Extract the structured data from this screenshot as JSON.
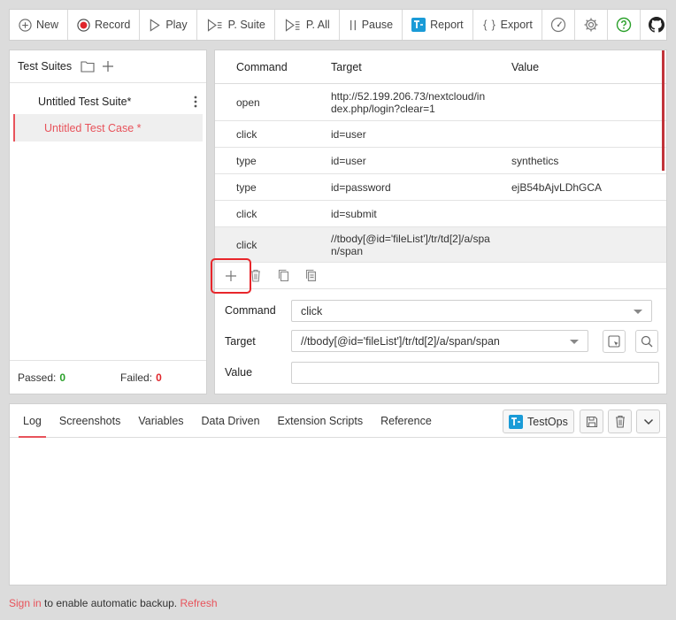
{
  "toolbar": {
    "new_label": "New",
    "record_label": "Record",
    "play_label": "Play",
    "psuite_label": "P. Suite",
    "pall_label": "P. All",
    "pause_label": "Pause",
    "report_label": "Report",
    "export_label": "Export"
  },
  "sidebar": {
    "title": "Test Suites",
    "suite_name": "Untitled Test Suite*",
    "case_name": "Untitled Test Case *",
    "passed_label": "Passed:",
    "passed_count": "0",
    "failed_label": "Failed:",
    "failed_count": "0"
  },
  "table": {
    "headers": {
      "command": "Command",
      "target": "Target",
      "value": "Value"
    },
    "rows": [
      {
        "command": "open",
        "target": "http://52.199.206.73/nextcloud/index.php/login?clear=1",
        "value": ""
      },
      {
        "command": "click",
        "target": "id=user",
        "value": ""
      },
      {
        "command": "type",
        "target": "id=user",
        "value": "synthetics"
      },
      {
        "command": "type",
        "target": "id=password",
        "value": "ejB54bAjvLDhGCA"
      },
      {
        "command": "click",
        "target": "id=submit",
        "value": ""
      },
      {
        "command": "click",
        "target": "//tbody[@id='fileList']/tr/td[2]/a/span/span",
        "value": ""
      }
    ]
  },
  "editor": {
    "command_label": "Command",
    "command_value": "click",
    "target_label": "Target",
    "target_value": "//tbody[@id='fileList']/tr/td[2]/a/span/span",
    "value_label": "Value",
    "value_value": ""
  },
  "bottom": {
    "tabs": [
      "Log",
      "Screenshots",
      "Variables",
      "Data Driven",
      "Extension Scripts",
      "Reference"
    ],
    "testops_label": "TestOps"
  },
  "footer": {
    "signin_link": "Sign in",
    "middle_text": " to enable automatic backup. ",
    "refresh_link": "Refresh"
  },
  "colors": {
    "accent": "#e8535b",
    "record_red": "#e0252b",
    "pass_green": "#2aa02a",
    "help_green": "#2aa02a",
    "testops_blue": "#1a9bd7"
  }
}
